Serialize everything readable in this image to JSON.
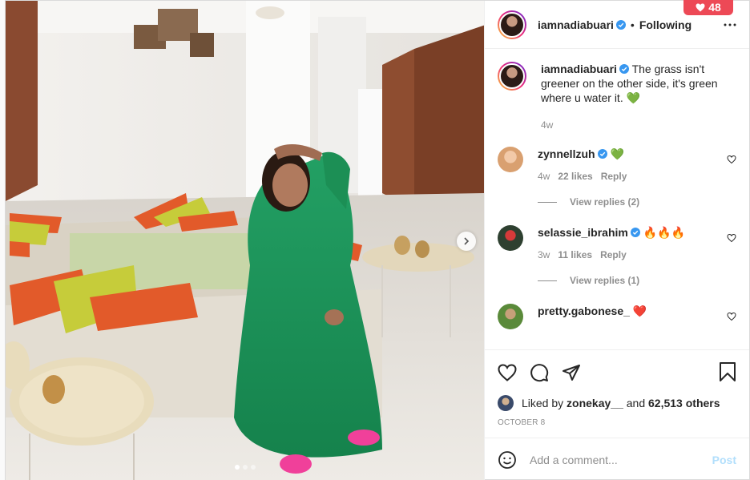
{
  "notification": {
    "count": "48",
    "icon": "heart-icon"
  },
  "post": {
    "username": "iamnadiabuari",
    "verified": true,
    "follow_state": "Following",
    "caption": "The grass isn't greener on the other side, it's green where u water it. 💚",
    "caption_age": "4w",
    "likes_prefix": "Liked by",
    "liked_by": "zonekay__",
    "likes_and": "and",
    "likes_count": "62,513 others",
    "date": "OCTOBER 8",
    "carousel": {
      "total": 3,
      "active": 1
    }
  },
  "comments": [
    {
      "username": "zynnellzuh",
      "verified": true,
      "text": "💚",
      "age": "4w",
      "likes": "22 likes",
      "reply": "Reply",
      "view_replies": "View replies (2)",
      "avatar_color": "#d9a070"
    },
    {
      "username": "selassie_ibrahim",
      "verified": true,
      "text": "🔥🔥🔥",
      "age": "3w",
      "likes": "11 likes",
      "reply": "Reply",
      "view_replies": "View replies (1)",
      "avatar_color": "#2e4030"
    },
    {
      "username": "pretty.gabonese_",
      "verified": false,
      "text": "❤️",
      "age": "",
      "likes": "",
      "reply": "",
      "view_replies": "",
      "avatar_color": "#5a8a3a"
    }
  ],
  "add_comment": {
    "placeholder": "Add a comment...",
    "post_label": "Post"
  },
  "colors": {
    "accent": "#0095f6",
    "post_disabled": "#b2dffc",
    "notification": "#ed4956",
    "dress": "#1f9a5a"
  }
}
